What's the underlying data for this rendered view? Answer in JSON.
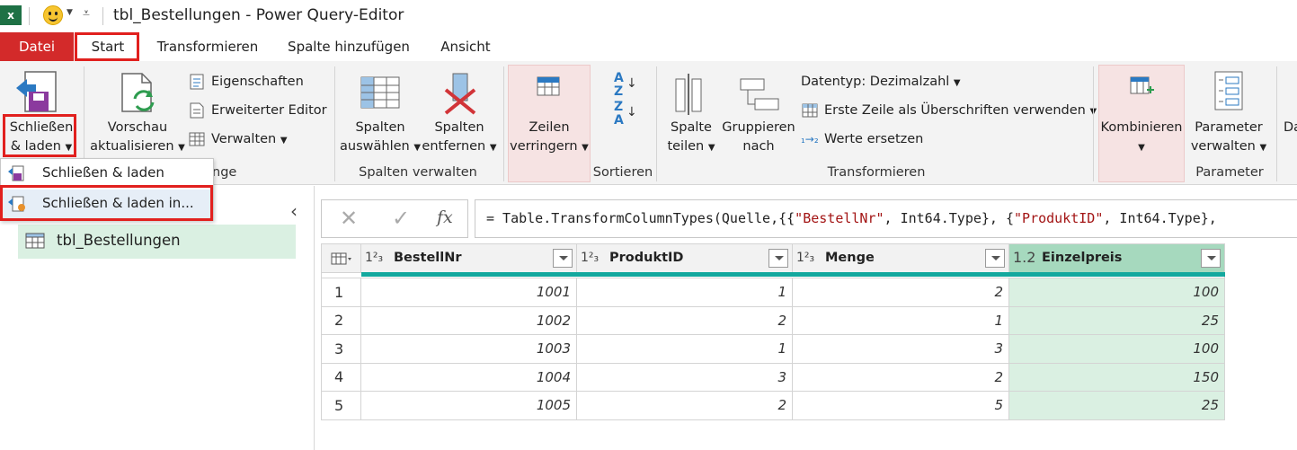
{
  "window": {
    "title": "tbl_Bestellungen - Power Query-Editor",
    "app_icon": "excel-icon"
  },
  "menu": {
    "tabs": [
      "Datei",
      "Start",
      "Transformieren",
      "Spalte hinzufügen",
      "Ansicht"
    ],
    "active_tab": "Start"
  },
  "ribbon": {
    "close_load": {
      "line1": "Schließen",
      "line2": "& laden"
    },
    "refresh_preview": {
      "line1": "Vorschau",
      "line2": "aktualisieren"
    },
    "properties": "Eigenschaften",
    "advanced_editor": "Erweiterter Editor",
    "manage": "Verwalten",
    "query_group_tail": "nge",
    "choose_columns": {
      "line1": "Spalten",
      "line2": "auswählen"
    },
    "remove_columns": {
      "line1": "Spalten",
      "line2": "entfernen"
    },
    "manage_columns_group": "Spalten verwalten",
    "reduce_rows": {
      "line1": "Zeilen",
      "line2": "verringern"
    },
    "sort_group": "Sortieren",
    "split_column": {
      "line1": "Spalte",
      "line2": "teilen"
    },
    "group_by": {
      "line1": "Gruppieren",
      "line2": "nach"
    },
    "data_type": "Datentyp: Dezimalzahl",
    "first_row_headers": "Erste Zeile als Überschriften verwenden",
    "replace_values": "Werte ersetzen",
    "transform_group": "Transformieren",
    "combine": "Kombinieren",
    "manage_parameters": {
      "line1": "Parameter",
      "line2": "verwalten"
    },
    "parameter_group": "Parameter",
    "cut_off": "Da"
  },
  "dropdown": {
    "items": [
      "Schließen & laden",
      "Schließen & laden in..."
    ]
  },
  "queries": {
    "items": [
      "tbl_Bestellungen"
    ]
  },
  "formula": {
    "prefix": "= Table.TransformColumnTypes(Quelle,{{",
    "s1": "\"BestellNr\"",
    "mid1": ", Int64.Type}, {",
    "s2": "\"ProduktID\"",
    "mid2": ", Int64.Type},",
    "fx": "fx"
  },
  "table": {
    "columns": [
      {
        "type": "1²₃",
        "name": "BestellNr"
      },
      {
        "type": "1²₃",
        "name": "ProduktID"
      },
      {
        "type": "1²₃",
        "name": "Menge"
      },
      {
        "type": "1.2",
        "name": "Einzelpreis"
      }
    ],
    "rows": [
      {
        "n": "1",
        "cells": [
          "1001",
          "1",
          "2",
          "100"
        ]
      },
      {
        "n": "2",
        "cells": [
          "1002",
          "2",
          "1",
          "25"
        ]
      },
      {
        "n": "3",
        "cells": [
          "1003",
          "1",
          "3",
          "100"
        ]
      },
      {
        "n": "4",
        "cells": [
          "1004",
          "3",
          "2",
          "150"
        ]
      },
      {
        "n": "5",
        "cells": [
          "1005",
          "2",
          "5",
          "25"
        ]
      }
    ]
  },
  "colors": {
    "file_tab": "#d32a2a",
    "highlight_box": "#e1201e",
    "selected_column": "#daf0e2",
    "column_accent": "#13a89e"
  }
}
